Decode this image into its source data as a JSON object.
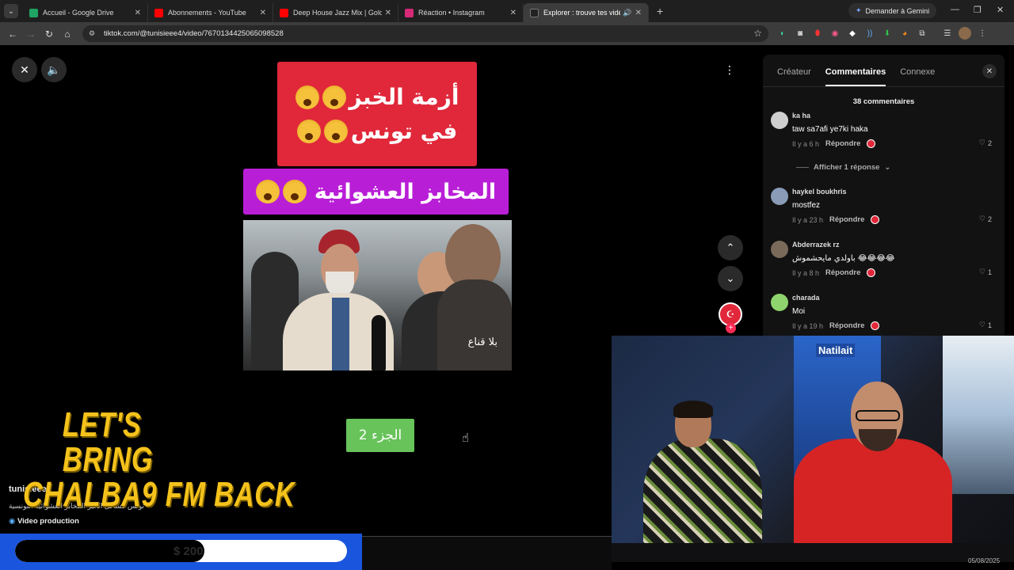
{
  "browser": {
    "tabs": [
      {
        "title": "Accueil - Google Drive",
        "color": "#1fa463",
        "active": false
      },
      {
        "title": "Abonnements - YouTube",
        "color": "#ff0000",
        "active": false
      },
      {
        "title": "Deep House Jazz Mix | Golden",
        "color": "#ff0000",
        "active": false
      },
      {
        "title": "Réaction • Instagram",
        "color": "#d62976",
        "active": false
      },
      {
        "title": "Explorer : trouve tes vidéos",
        "color": "#222222",
        "active": true
      }
    ],
    "new_tab": "+",
    "gemini_label": "Demander à Gemini",
    "url": "tiktok.com/@tunisieee4/video/7670134425065098528"
  },
  "video": {
    "banner_line1": "أزمة الخبز",
    "banner_line2": "في تونس",
    "banner_purple": "المخابز العشوائية",
    "photo_caption": "بلا قناع",
    "part_label": "الجزء 2",
    "live_avatar_text": "☪",
    "author": "tunisieee4",
    "description": "تونس مشاكل الخبز المخابز العشوائية التونسية",
    "sound": "Video production"
  },
  "overlay": {
    "line1": "LET'S BRING",
    "line2": "CHALBA9 FM BACK",
    "progress_label": "$ 200",
    "progress_fraction": 0.57
  },
  "comments_panel": {
    "tabs": [
      "Créateur",
      "Commentaires",
      "Connexe"
    ],
    "active_tab": 1,
    "count": "38 commentaires",
    "reply_label": "Répondre",
    "show_replies": "Afficher 1 réponse",
    "items": [
      {
        "user": "ka ha",
        "text": "taw sa7afi ye7ki haka",
        "time": "Il y a 6 h",
        "likes": "2",
        "avatar": "#cfcfcf"
      },
      {
        "user": "haykel boukhris",
        "text": "mostfez",
        "time": "Il y a 23 h",
        "likes": "2",
        "avatar": "#8a9bb8"
      },
      {
        "user": "Abderrazek rz",
        "text": "باولدي مايحشموش 😂😂😂😂",
        "time": "Il y a 8 h",
        "likes": "1",
        "avatar": "#7a6a5a"
      },
      {
        "user": "charada",
        "text": "Moi",
        "time": "Il y a 19 h",
        "likes": "1",
        "avatar": "#8fd36e"
      }
    ]
  },
  "webcam": {
    "logo_text": "Natilait"
  },
  "taskbar_date": "05/08/2025",
  "colors": {
    "progress_bar_bg": "#1a55dd",
    "banner_red": "#e0283a",
    "banner_purple": "#b91ed7",
    "part_green": "#67c35a",
    "overlay_yellow": "#f4c21b"
  }
}
